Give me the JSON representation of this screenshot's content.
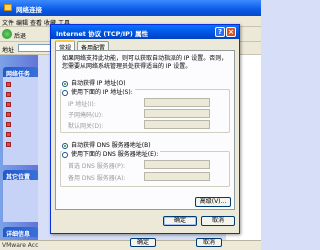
{
  "background": {
    "title": "网络连接",
    "menu": [
      "文件",
      "编辑",
      "查看",
      "收藏",
      "工具"
    ],
    "back_label": "后退",
    "address_label": "地址",
    "left_heads": [
      "网络任务",
      "其它位置",
      "详细信息"
    ],
    "status_text": "VMware Acc",
    "ok_label": "确定",
    "cancel_label": "取消"
  },
  "dialog": {
    "title": "Internet 协议 (TCP/IP) 属性",
    "help_glyph": "?",
    "close_glyph": "×",
    "tabs": [
      "常规",
      "备用配置"
    ],
    "description": "如果网络支持此功能，则可以获取自动指派的 IP 设置。否则，您需要从网络系统管理员处获得适当的 IP 设置。",
    "ip_auto": "自动获得 IP 地址(O)",
    "ip_manual": "使用下面的 IP 地址(S):",
    "ip_fields": [
      "IP 地址(I):",
      "子网掩码(U):",
      "默认网关(D):"
    ],
    "dns_auto": "自动获得 DNS 服务器地址(B)",
    "dns_manual": "使用下面的 DNS 服务器地址(E):",
    "dns_fields": [
      "首选 DNS 服务器(P):",
      "备用 DNS 服务器(A):"
    ],
    "advanced_label": "高级(V)...",
    "ok_label": "确定",
    "cancel_label": "取消"
  },
  "colors": {
    "title_blue": "#0054e3",
    "desktop": "#d6dff7"
  }
}
